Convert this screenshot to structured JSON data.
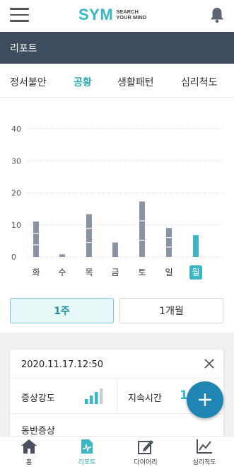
{
  "header": {
    "logo_main": "SYM",
    "logo_sub_line1": "SEARCH",
    "logo_sub_line2": "YOUR MIND",
    "menu_icon": "hamburger-icon",
    "notification_icon": "bell-icon"
  },
  "titlebar": {
    "title": "리포트"
  },
  "tabs": [
    {
      "label": "정서불안",
      "active": false
    },
    {
      "label": "공황",
      "active": true
    },
    {
      "label": "생활패턴",
      "active": false
    },
    {
      "label": "심리척도",
      "active": false
    }
  ],
  "chart_data": {
    "type": "bar",
    "categories": [
      "화",
      "수",
      "목",
      "금",
      "토",
      "일",
      "월"
    ],
    "values": [
      11,
      0.8,
      13.3,
      4.5,
      17.3,
      9,
      6.8
    ],
    "highlight_index": 6,
    "y_ticks": [
      "0",
      "10",
      "20",
      "30",
      "40"
    ],
    "ylim": [
      0,
      40
    ],
    "bar_color": "#8a93a3",
    "highlight_color": "#3ab6c4",
    "grid": true
  },
  "period": {
    "week_label": "1주",
    "month_label": "1개월",
    "selected": "week"
  },
  "record": {
    "datetime": "2020.11.17.12:50",
    "intensity_label": "증상강도",
    "duration_label": "지속시간",
    "duration_value": "1",
    "accompanying_label": "동반증상",
    "close_icon": "close-icon",
    "intensity_level": 3,
    "intensity_max": 4
  },
  "fab": {
    "icon": "plus-icon"
  },
  "bottom_nav": [
    {
      "label": "홈",
      "icon": "home-icon",
      "active": false
    },
    {
      "label": "리포트",
      "icon": "report-icon",
      "active": true
    },
    {
      "label": "다이어리",
      "icon": "diary-icon",
      "active": false
    },
    {
      "label": "심리척도",
      "icon": "scale-chart-icon",
      "active": false
    }
  ],
  "colors": {
    "accent": "#35b7c5",
    "titlebar": "#3f4b5e",
    "fab": "#1f86b3"
  }
}
